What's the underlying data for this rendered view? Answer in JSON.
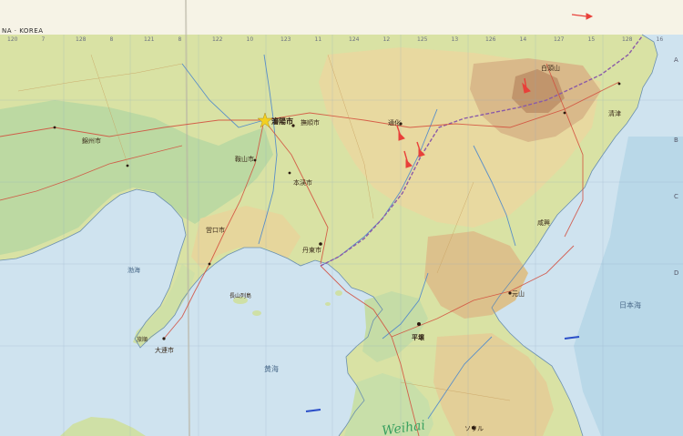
{
  "map": {
    "title": "NA · KOREA",
    "top_longitudes": [
      "120",
      "7",
      "128",
      "8",
      "121",
      "8",
      "122",
      "10",
      "123",
      "11",
      "124",
      "12",
      "125",
      "13",
      "126",
      "14",
      "127",
      "15",
      "128",
      "16"
    ],
    "right_edge_letters": [
      "A",
      "B",
      "C",
      "D"
    ],
    "colors": {
      "sea": "#cfe3ef",
      "deep_sea": "#a9cde0",
      "lowland": "#bcd9a2",
      "upland": "#e8d9a0",
      "highland": "#d9b98a",
      "mountain": "#b88a62",
      "road": "#d24a3a",
      "river": "#5a8fc8",
      "border": "#8a5aa8",
      "red_mark": "#e8403a",
      "blue_mark": "#2a4ec8"
    },
    "labels": [
      {
        "key": "shenyang",
        "text": "瀋陽市"
      },
      {
        "key": "fushun",
        "text": "撫順市"
      },
      {
        "key": "anshan",
        "text": "鞍山市"
      },
      {
        "key": "benxi",
        "text": "本渓市"
      },
      {
        "key": "dandong",
        "text": "丹東市"
      },
      {
        "key": "dalian",
        "text": "大連市"
      },
      {
        "key": "lushun",
        "text": "旅順"
      },
      {
        "key": "yingkou",
        "text": "営口市"
      },
      {
        "key": "jinzhou",
        "text": "錦州市"
      },
      {
        "key": "tonghua",
        "text": "通化"
      },
      {
        "key": "pyongyang",
        "text": "平壌"
      },
      {
        "key": "wonsan",
        "text": "元山"
      },
      {
        "key": "seoul_area",
        "text": "ソウル"
      },
      {
        "key": "changshan",
        "text": "長山列島"
      },
      {
        "key": "bohai",
        "text": "渤海"
      },
      {
        "key": "yellow_sea",
        "text": "黄海"
      },
      {
        "key": "east_sea",
        "text": "日本海"
      },
      {
        "key": "baitou",
        "text": "白頭山"
      },
      {
        "key": "hamhung",
        "text": "咸興"
      },
      {
        "key": "chongjin",
        "text": "清津"
      },
      {
        "key": "handwritten",
        "text": "Weihai"
      }
    ]
  }
}
